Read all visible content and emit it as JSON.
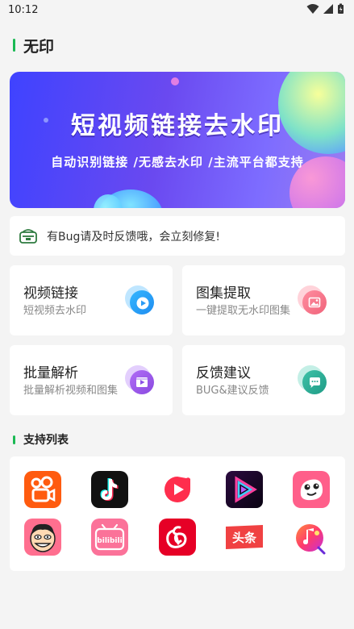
{
  "status_bar": {
    "time": "10:12"
  },
  "header": {
    "title": "无印"
  },
  "banner": {
    "title": "短视频链接去水印",
    "subtitle": "自动识别链接 /无感去水印 /主流平台都支持"
  },
  "notice": {
    "text": "有Bug请及时反馈哦，会立刻修复!"
  },
  "cards": [
    {
      "title": "视频链接",
      "desc": "短视频去水印"
    },
    {
      "title": "图集提取",
      "desc": "一键提取无水印图集"
    },
    {
      "title": "批量解析",
      "desc": "批量解析视频和图集"
    },
    {
      "title": "反馈建议",
      "desc": "BUG&建议反馈"
    }
  ],
  "support": {
    "title": "支持列表",
    "apps": [
      {
        "icon": "kuaishou-icon",
        "color": "#ff5b0f"
      },
      {
        "icon": "douyin-icon",
        "color": "#111111"
      },
      {
        "icon": "weishi-icon",
        "color": "#ff2e4d"
      },
      {
        "icon": "video-app-icon",
        "color": "#1a0d2e"
      },
      {
        "icon": "pipixia-icon",
        "color": "#ff5f8a"
      },
      {
        "icon": "zuiyou-icon",
        "color": "#ff6f8f"
      },
      {
        "icon": "bilibili-icon",
        "color": "#fb7299"
      },
      {
        "icon": "netease-music-icon",
        "color": "#e60026"
      },
      {
        "icon": "toutiao-icon",
        "color": "#f04142"
      },
      {
        "icon": "music-app-icon",
        "color": "#ff3b6b"
      }
    ],
    "toutiao_text": "头条",
    "bilibili_text": "bilibili"
  }
}
